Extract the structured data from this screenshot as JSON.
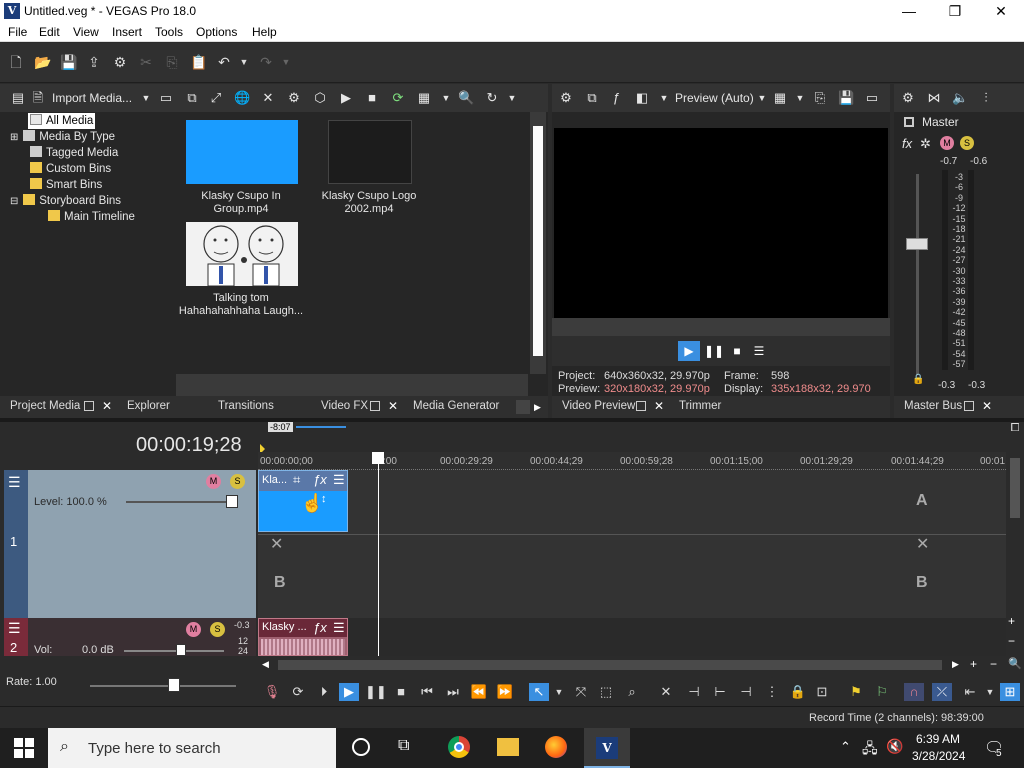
{
  "window": {
    "title": "Untitled.veg * - VEGAS Pro 18.0",
    "app_icon": "V",
    "minimize": "—",
    "maximize": "❐",
    "close": "✕"
  },
  "menu": [
    "File",
    "Edit",
    "View",
    "Insert",
    "Tools",
    "Options",
    "Help"
  ],
  "project_media": {
    "import_label": "Import Media...",
    "tree": [
      "All Media",
      "Media By Type",
      "Tagged Media",
      "Custom Bins",
      "Smart Bins",
      "Storyboard Bins",
      "Main Timeline"
    ],
    "media": [
      {
        "name": "Klasky Csupo In Group.mp4"
      },
      {
        "name": "Klasky Csupo Logo 2002.mp4"
      },
      {
        "name": "Talking tom Hahahahahhaha Laugh..."
      }
    ],
    "tabs": [
      "Project Media",
      "Explorer",
      "Transitions",
      "Video FX",
      "Media Generator"
    ]
  },
  "preview": {
    "mode": "Preview (Auto)",
    "project_label": "Project:",
    "project_value": "640x360x32, 29.970p",
    "frame_label": "Frame:",
    "frame_value": "598",
    "preview_label": "Preview:",
    "preview_value": "320x180x32, 29.970p",
    "display_label": "Display:",
    "display_value": "335x188x32, 29.970",
    "tabs": [
      "Video Preview",
      "Trimmer"
    ]
  },
  "master": {
    "label": "Master",
    "peak_left": "-0.7",
    "peak_right": "-0.6",
    "scale": [
      "3",
      "6",
      "9",
      "12",
      "15",
      "18",
      "21",
      "24",
      "27",
      "30",
      "33",
      "36",
      "39",
      "42",
      "45",
      "48",
      "51",
      "54",
      "57"
    ],
    "bottom_left": "-0.3",
    "bottom_right": "-0.3",
    "tab": "Master Bus"
  },
  "timeline": {
    "timecode": "00:00:19;28",
    "cursor_offset": "-8:07",
    "ruler": [
      "00:00:00;00",
      "00:00:29:29",
      "00:00:44;29",
      "00:00:59;28",
      "00:01:15;00",
      "00:01:29;29",
      "00:01:44;29",
      "00:01"
    ],
    "ruler_mid": ":00",
    "video_track": {
      "level": "Level: 100.0 %",
      "number": "1",
      "clip": "Kla...",
      "lane_a": "A",
      "lane_b": "B"
    },
    "audio_track": {
      "vol_label": "Vol:",
      "vol_value": "0.0 dB",
      "number": "2",
      "clip": "Klasky ...",
      "meter_a": "-0.3",
      "meter_b": "12",
      "meter_c": "24"
    },
    "rate": "Rate: 1.00"
  },
  "status": {
    "record_time": "Record Time (2 channels): 98:39:00"
  },
  "taskbar": {
    "search_placeholder": "Type here to search",
    "time": "6:39 AM",
    "date": "3/28/2024",
    "notif_count": "5"
  },
  "colors": {
    "accent": "#3a8fe0",
    "clip_blue": "#1a9cff",
    "audio_red": "#7a2b3a",
    "track_video": "#8fa2b0"
  }
}
